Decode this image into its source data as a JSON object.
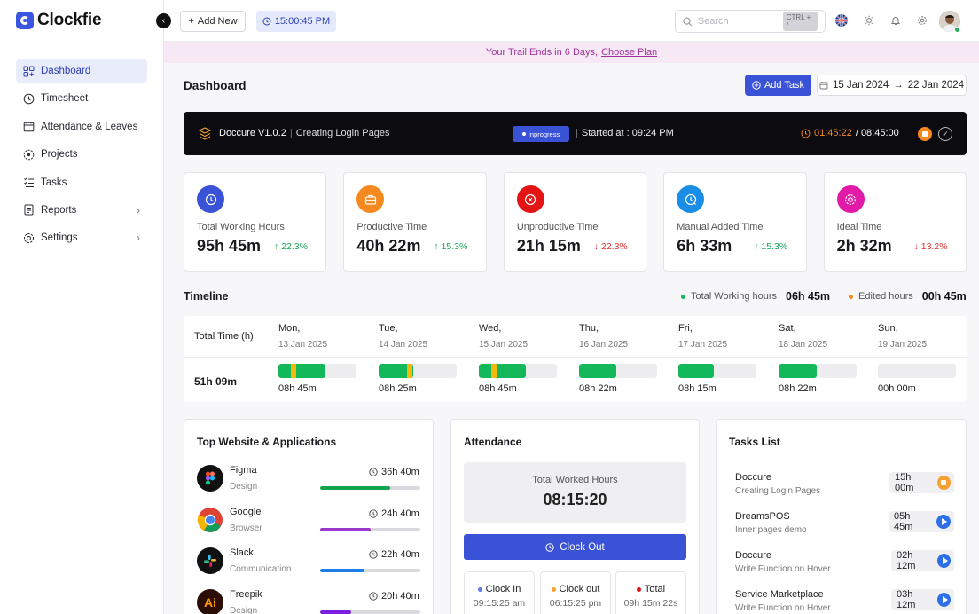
{
  "app": {
    "name": "Clockfie"
  },
  "sidebar": {
    "items": [
      {
        "label": "Dashboard",
        "icon": "grid-icon",
        "active": true
      },
      {
        "label": "Timesheet",
        "icon": "clock-icon"
      },
      {
        "label": "Attendance & Leaves",
        "icon": "calendar-icon"
      },
      {
        "label": "Projects",
        "icon": "projects-icon"
      },
      {
        "label": "Tasks",
        "icon": "tasks-icon"
      },
      {
        "label": "Reports",
        "icon": "reports-icon",
        "chevron": true
      },
      {
        "label": "Settings",
        "icon": "gear-icon",
        "chevron": true
      }
    ]
  },
  "topbar": {
    "add_new": "Add New",
    "clock": "15:00:45 PM",
    "search_placeholder": "Search",
    "search_shortcut": "CTRL + /"
  },
  "banner": {
    "text": "Your Trail Ends in 6 Days,",
    "link": "Choose Plan"
  },
  "header": {
    "title": "Dashboard",
    "add_task": "Add Task",
    "date_from": "15 Jan 2024",
    "date_to": "22 Jan 2024"
  },
  "current_task": {
    "project": "Doccure V1.0.2",
    "task": "Creating Login Pages",
    "status": "Inprogress",
    "started": "Started at : 09:24 PM",
    "elapsed": "01:45:22",
    "total": "/ 08:45:00"
  },
  "stats": [
    {
      "label": "Total Working Hours",
      "value": "95h 45m",
      "delta": "22.3%",
      "trend": "up",
      "color": "#3a52d6"
    },
    {
      "label": "Productive Time",
      "value": "40h 22m",
      "delta": "15.3%",
      "trend": "up",
      "color": "#f5891f"
    },
    {
      "label": "Unproductive Time",
      "value": "21h 15m",
      "delta": "22.3%",
      "trend": "down",
      "color": "#e21414"
    },
    {
      "label": "Manual Added Time",
      "value": "6h 33m",
      "delta": "15.3%",
      "trend": "up",
      "color": "#1a8ee6"
    },
    {
      "label": "Ideal Time",
      "value": "2h 32m",
      "delta": "13.2%",
      "trend": "down",
      "color": "#e11ba7"
    }
  ],
  "timeline": {
    "title": "Timeline",
    "legend": [
      {
        "label": "Total Working hours",
        "value": "06h 45m",
        "color": "#12b85a"
      },
      {
        "label": "Edited hours",
        "value": "00h 45m",
        "color": "#f5891f"
      }
    ],
    "total_label": "Total Time (h)",
    "total_value": "51h 09m",
    "days": [
      {
        "day": "Mon,",
        "date": "13 Jan 2025",
        "hours": "08h 45m",
        "fill": 0.6,
        "edit": 0.16
      },
      {
        "day": "Tue,",
        "date": "14 Jan 2025",
        "hours": "08h 25m",
        "fill": 0.44,
        "edit": 0.36
      },
      {
        "day": "Wed,",
        "date": "15 Jan 2025",
        "hours": "08h 45m",
        "fill": 0.6,
        "edit": 0.16
      },
      {
        "day": "Thu,",
        "date": "16 Jan 2025",
        "hours": "08h 22m",
        "fill": 0.48,
        "edit": null
      },
      {
        "day": "Fri,",
        "date": "17 Jan 2025",
        "hours": "08h 15m",
        "fill": 0.45,
        "edit": null
      },
      {
        "day": "Sat,",
        "date": "18 Jan 2025",
        "hours": "08h 22m",
        "fill": 0.49,
        "edit": null
      },
      {
        "day": "Sun,",
        "date": "19 Jan 2025",
        "hours": "00h 00m",
        "fill": 0,
        "edit": null
      }
    ]
  },
  "top_apps": {
    "title": "Top Website & Applications",
    "items": [
      {
        "name": "Figma",
        "category": "Design",
        "time": "36h 40m",
        "progress": 0.7,
        "color": "#12a34f",
        "logo_bg": "#111",
        "logo": "figma-logo-icon"
      },
      {
        "name": "Google",
        "category": "Browser",
        "time": "24h 40m",
        "progress": 0.5,
        "color": "#9a38c9",
        "logo_bg": "#ffffff",
        "logo": "chrome-logo-icon"
      },
      {
        "name": "Slack",
        "category": "Communication",
        "time": "22h 40m",
        "progress": 0.44,
        "color": "#1a7ee6",
        "logo_bg": "#111",
        "logo": "slack-logo-icon"
      },
      {
        "name": "Freepik",
        "category": "Design",
        "time": "20h 40m",
        "progress": 0.31,
        "color": "#7a1fe0",
        "logo_bg": "#2a0d05",
        "logo_text": "Ai",
        "logo": "illustrator-logo-icon"
      }
    ]
  },
  "attendance": {
    "title": "Attendance",
    "worked_label": "Total Worked Hours",
    "worked_value": "08:15:20",
    "clock_out": "Clock Out",
    "items": [
      {
        "label": "Clock In",
        "value": "09:15:25 am",
        "color": "#5a7be8"
      },
      {
        "label": "Clock out",
        "value": "06:15:25 pm",
        "color": "#f5a133"
      },
      {
        "label": "Total",
        "value": "09h 15m 22s",
        "color": "#e21414"
      }
    ]
  },
  "tasks": {
    "title": "Tasks List",
    "items": [
      {
        "project": "Doccure",
        "task": "Creating Login Pages",
        "time": "15h 00m",
        "control": "stop"
      },
      {
        "project": "DreamsPOS",
        "task": "Inner pages demo",
        "time": "05h 45m",
        "control": "play"
      },
      {
        "project": "Doccure",
        "task": "Write Function on Hover",
        "time": "02h 12m",
        "control": "play"
      },
      {
        "project": "Service Marketplace",
        "task": "Write Function on Hover",
        "time": "03h 12m",
        "control": "play"
      }
    ]
  }
}
